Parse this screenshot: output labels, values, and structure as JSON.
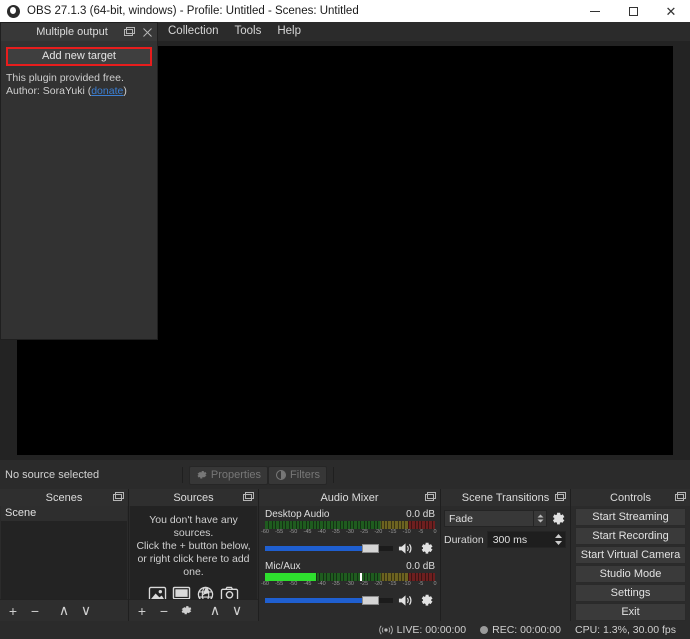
{
  "window": {
    "title": "OBS 27.1.3 (64-bit, windows) - Profile: Untitled - Scenes: Untitled",
    "logo_icon": "obs-logo-icon",
    "minimize_icon": "minimize-icon",
    "maximize_icon": "maximize-icon",
    "close_icon": "close-icon"
  },
  "menubar": {
    "items": [
      {
        "label": "Collection"
      },
      {
        "label": "Tools"
      },
      {
        "label": "Help"
      }
    ]
  },
  "plugin_dock": {
    "title": "Multiple output",
    "float_icon": "dock-float-icon",
    "close_icon": "dock-close-icon",
    "add_button": "Add new target",
    "note_line1": "This plugin provided free.",
    "note_prefix": "Author: SoraYuki (",
    "note_link": "donate",
    "note_suffix": ")",
    "accent_color": "#e81d1d"
  },
  "preview": {
    "canvas_color": "#000000",
    "background_color": "#232323"
  },
  "source_bar": {
    "status": "No source selected",
    "properties_label": "Properties",
    "properties_icon": "gear-icon",
    "filters_label": "Filters",
    "filters_icon": "filters-icon"
  },
  "scenes": {
    "title": "Scenes",
    "float_icon": "dock-float-icon",
    "items": [
      {
        "label": "Scene"
      }
    ],
    "toolbar": [
      {
        "name": "add-scene-button",
        "glyph": "+"
      },
      {
        "name": "remove-scene-button",
        "glyph": "−"
      },
      {
        "name": "move-scene-up-button",
        "glyph": "∧"
      },
      {
        "name": "move-scene-down-button",
        "glyph": "∨"
      }
    ]
  },
  "sources": {
    "title": "Sources",
    "float_icon": "dock-float-icon",
    "empty_line1": "You don't have any sources.",
    "empty_line2": "Click the + button below,",
    "empty_line3": "or right click here to add one.",
    "type_icons": [
      "image-source-icon",
      "display-capture-icon",
      "browser-source-icon",
      "camera-source-icon"
    ],
    "toolbar": [
      {
        "name": "add-source-button",
        "glyph": "+"
      },
      {
        "name": "remove-source-button",
        "glyph": "−"
      },
      {
        "name": "source-properties-button",
        "glyph": "gear"
      },
      {
        "name": "move-source-up-button",
        "glyph": "∧"
      },
      {
        "name": "move-source-down-button",
        "glyph": "∨"
      }
    ]
  },
  "audio_mixer": {
    "title": "Audio Mixer",
    "float_icon": "dock-float-icon",
    "scale_labels": [
      "-60",
      "-55",
      "-50",
      "-45",
      "-40",
      "-35",
      "-30",
      "-25",
      "-20",
      "-15",
      "-10",
      "-5",
      "0"
    ],
    "tracks": [
      {
        "name": "Desktop Audio",
        "db": "0.0 dB",
        "level_percent": 0,
        "peak_percent": 0,
        "volume_percent": 76,
        "mute_icon": "speaker-icon",
        "settings_icon": "gear-icon"
      },
      {
        "name": "Mic/Aux",
        "db": "0.0 dB",
        "level_percent": 30,
        "peak_percent": 56,
        "volume_percent": 76,
        "mute_icon": "speaker-icon",
        "settings_icon": "gear-icon"
      }
    ]
  },
  "scene_transitions": {
    "title": "Scene Transitions",
    "float_icon": "dock-float-icon",
    "transition_value": "Fade",
    "transition_config_icon": "gear-icon",
    "duration_label": "Duration",
    "duration_value": "300 ms"
  },
  "controls": {
    "title": "Controls",
    "float_icon": "dock-float-icon",
    "buttons": [
      {
        "label": "Start Streaming",
        "name": "start-streaming-button"
      },
      {
        "label": "Start Recording",
        "name": "start-recording-button"
      },
      {
        "label": "Start Virtual Camera",
        "name": "start-virtual-camera-button"
      },
      {
        "label": "Studio Mode",
        "name": "studio-mode-button"
      },
      {
        "label": "Settings",
        "name": "settings-button"
      },
      {
        "label": "Exit",
        "name": "exit-button"
      }
    ]
  },
  "statusbar": {
    "live_icon": "broadcast-icon",
    "live": "LIVE: 00:00:00",
    "rec_icon": "record-dot-icon",
    "rec": "REC: 00:00:00",
    "cpu": "CPU: 1.3%, 30.00 fps"
  }
}
